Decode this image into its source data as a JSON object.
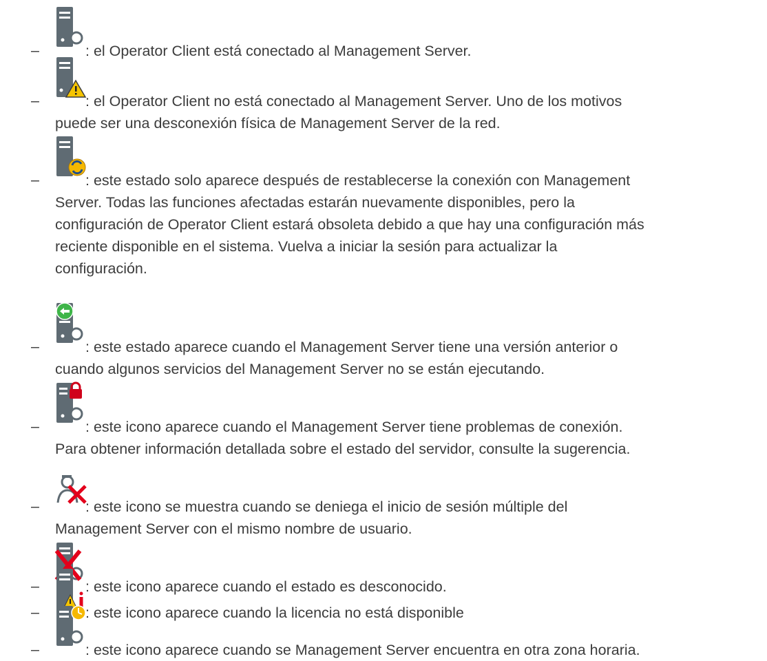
{
  "items": [
    {
      "icon": "server-connected-icon",
      "line1": ": el Operator Client está conectado al Management Server."
    },
    {
      "icon": "server-warning-icon",
      "line1": ": el Operator Client no está conectado al Management Server. Uno de los motivos",
      "rest": [
        "puede ser una desconexión física de Management Server de la red."
      ]
    },
    {
      "icon": "server-refresh-icon",
      "line1": ": este estado solo aparece después de restablecerse la conexión con Management",
      "rest": [
        "Server. Todas las funciones afectadas estarán nuevamente disponibles, pero la",
        "configuración de Operator Client estará obsoleta debido a que hay una configuración más",
        "reciente disponible en el sistema. Vuelva a iniciar la sesión para actualizar la",
        "configuración."
      ]
    },
    {
      "icon": "server-old-version-icon",
      "line1": ": este estado aparece cuando el Management Server tiene una versión anterior o",
      "rest": [
        "cuando algunos servicios del Management Server no se están ejecutando."
      ]
    },
    {
      "icon": "server-lock-icon",
      "line1": ": este icono aparece cuando el Management Server tiene problemas de conexión.",
      "rest": [
        "Para obtener información detallada sobre el estado del servidor, consulte la sugerencia."
      ]
    },
    {
      "icon": "user-login-denied-icon",
      "line1": ": este icono se muestra cuando se deniega el inicio de sesión múltiple del",
      "rest": [
        "Management Server con el mismo nombre de usuario."
      ]
    },
    {
      "icon": "server-unknown-icon",
      "line1": ": este icono aparece cuando el estado es desconocido."
    },
    {
      "icon": "server-license-icon",
      "line1": ": este icono aparece cuando la licencia no está disponible"
    },
    {
      "icon": "server-timezone-icon",
      "line1": ": este icono aparece cuando se Management Server encuentra en otra zona horaria."
    }
  ],
  "bullet": "–"
}
